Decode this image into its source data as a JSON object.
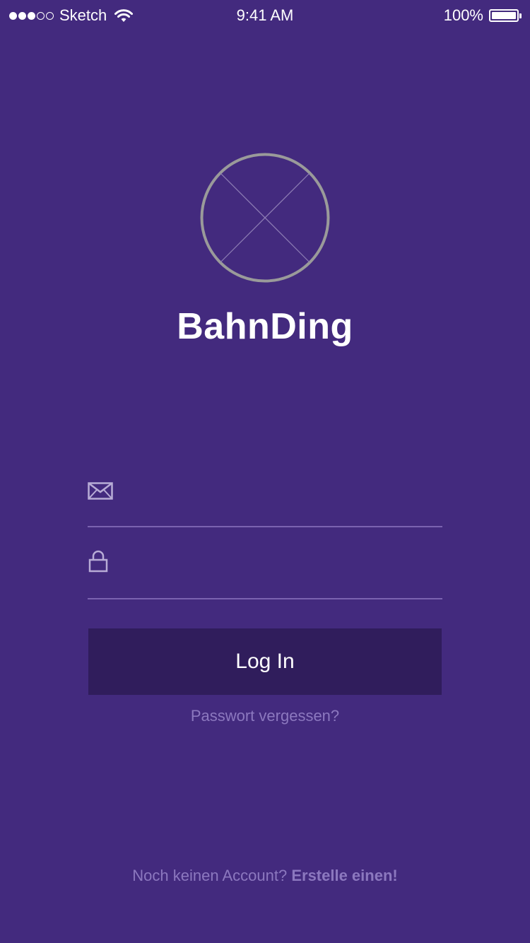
{
  "status_bar": {
    "carrier": "Sketch",
    "time": "9:41 AM",
    "battery_percent": "100%",
    "battery_level": 1.0,
    "signal_bars_filled": 3,
    "signal_bars_total": 5
  },
  "app": {
    "name": "BahnDing",
    "logo_icon": "placeholder-circle-x-icon"
  },
  "form": {
    "email_icon": "mail-icon",
    "email_value": "",
    "password_icon": "lock-icon",
    "password_value": "",
    "login_label": "Log In",
    "forgot_password": "Passwort vergessen?"
  },
  "footer": {
    "prompt": "Noch keinen Account?",
    "link": "Erstelle einen!"
  },
  "colors": {
    "background": "#432a7e",
    "button": "#301d5c",
    "muted_text": "#8c78bf",
    "divider": "#7b63b0",
    "logo_stroke": "#9a9a9a"
  }
}
